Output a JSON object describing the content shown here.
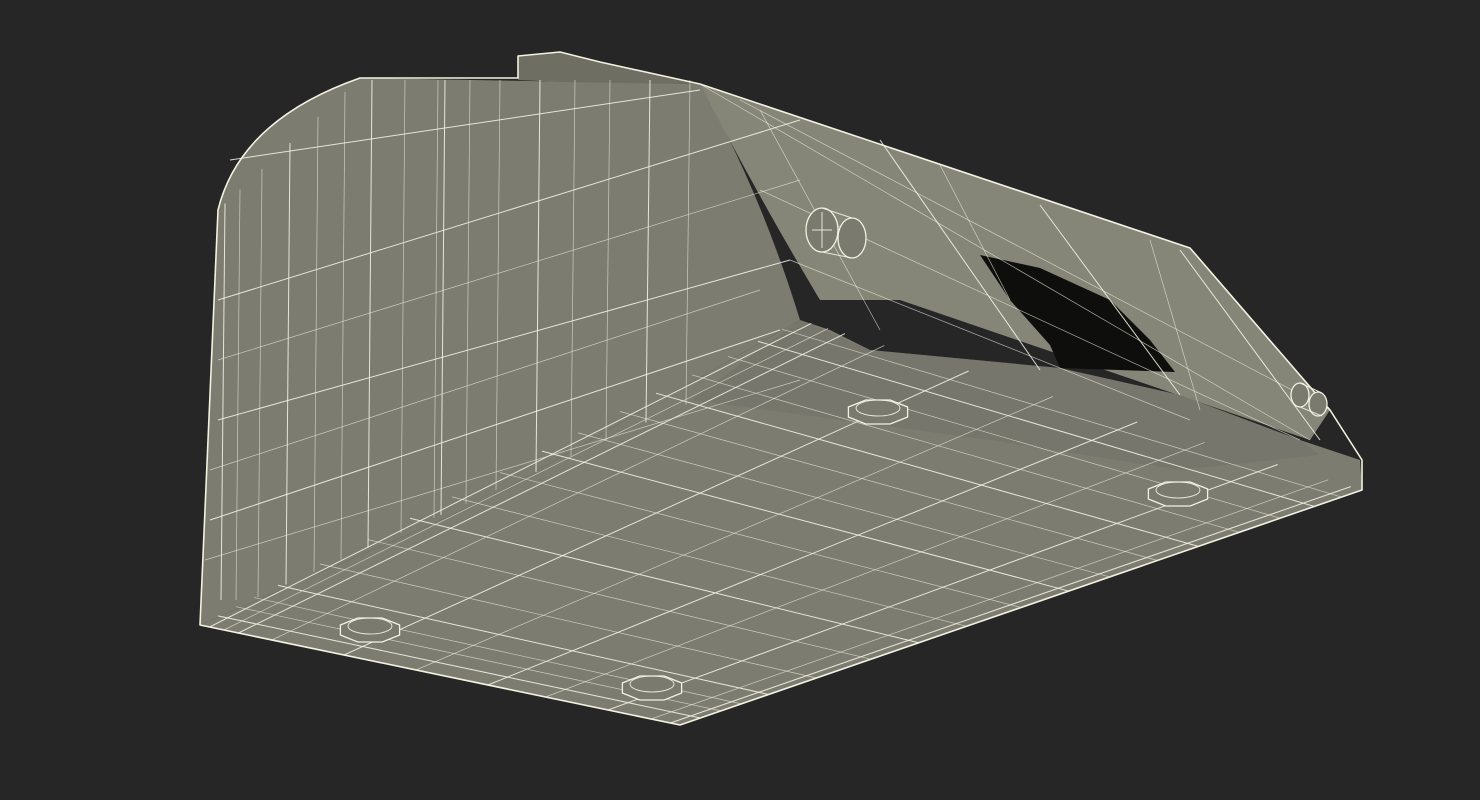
{
  "scene": {
    "background_color": "#262626",
    "model_face_color": "#7c7c70",
    "wireframe_color": "#f4f4e6",
    "opening_color": "#0e0f0d",
    "render_mode": "wireframe-over-shaded"
  }
}
